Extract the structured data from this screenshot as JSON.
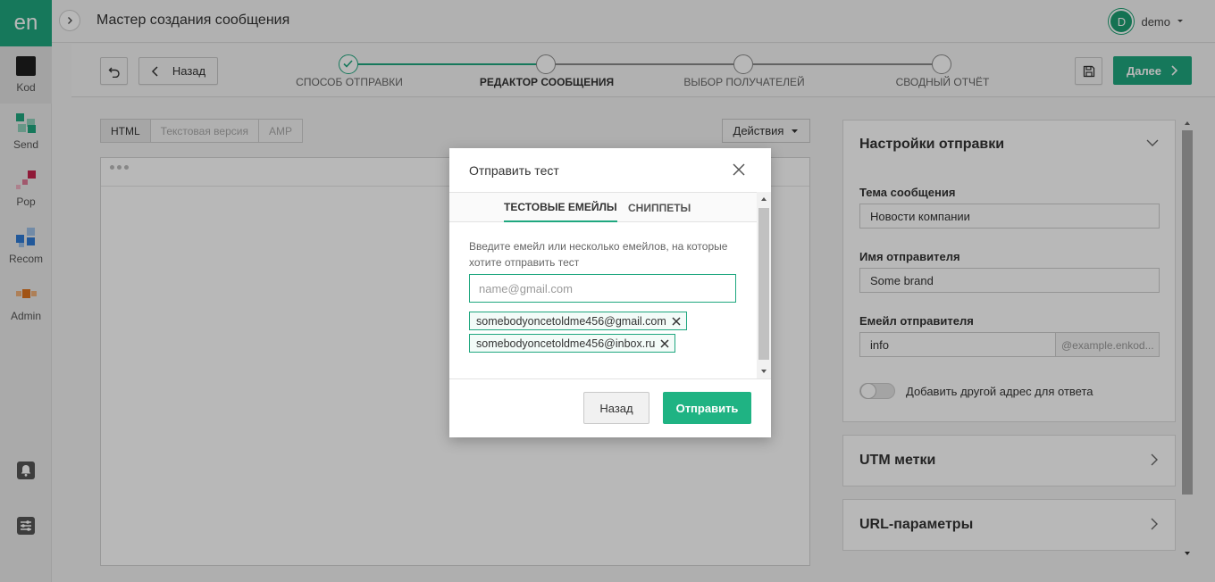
{
  "app": {
    "logo": "en",
    "title": "Мастер создания сообщения",
    "user": {
      "initial": "D",
      "name": "demo"
    }
  },
  "sidebar": {
    "items": [
      {
        "label": "Kod",
        "icon": "square-icon"
      },
      {
        "label": "Send",
        "icon": "grid-icon"
      },
      {
        "label": "Pop",
        "icon": "popup-icon"
      },
      {
        "label": "Recom",
        "icon": "blocks-icon"
      },
      {
        "label": "Admin",
        "icon": "admin-icon"
      }
    ],
    "bottom_icons": [
      "bell-icon",
      "sliders-icon"
    ]
  },
  "wizard": {
    "back_label": "Назад",
    "next_label": "Далее",
    "steps": [
      {
        "label": "СПОСОБ ОТПРАВКИ",
        "state": "done"
      },
      {
        "label": "РЕДАКТОР СООБЩЕНИЯ",
        "state": "active"
      },
      {
        "label": "ВЫБОР ПОЛУЧАТЕЛЕЙ",
        "state": "pending"
      },
      {
        "label": "СВОДНЫЙ ОТЧЁТ",
        "state": "pending"
      }
    ]
  },
  "editor": {
    "tabs": [
      "HTML",
      "Текстовая версия",
      "AMP"
    ],
    "active_tab": "HTML",
    "actions_label": "Действия"
  },
  "settings": {
    "title": "Настройки отправки",
    "subject_label": "Тема сообщения",
    "subject_value": "Новости компании",
    "sender_name_label": "Имя отправителя",
    "sender_name_value": "Some brand",
    "sender_email_label": "Емейл отправителя",
    "sender_email_value": "info",
    "sender_email_domain": "@example.enkod...",
    "reply_toggle_label": "Добавить другой адрес для ответа",
    "reply_toggle_on": false
  },
  "sections": [
    {
      "title": "UTM метки"
    },
    {
      "title": "URL-параметры"
    }
  ],
  "modal": {
    "title": "Отправить тест",
    "tabs": [
      "ТЕСТОВЫЕ ЕМЕЙЛЫ",
      "СНИППЕТЫ"
    ],
    "active_tab": "ТЕСТОВЫЕ ЕМЕЙЛЫ",
    "hint": "Введите емейл или несколько емейлов, на которые хотите отправить тест",
    "input_placeholder": "name@gmail.com",
    "emails": [
      "somebodyoncetoldme456@gmail.com",
      "somebodyoncetoldme456@inbox.ru"
    ],
    "back_label": "Назад",
    "send_label": "Отправить"
  },
  "colors": {
    "accent": "#1fa77f",
    "send_button": "#1fb383",
    "overlay": "rgba(0,0,0,0.28)"
  }
}
